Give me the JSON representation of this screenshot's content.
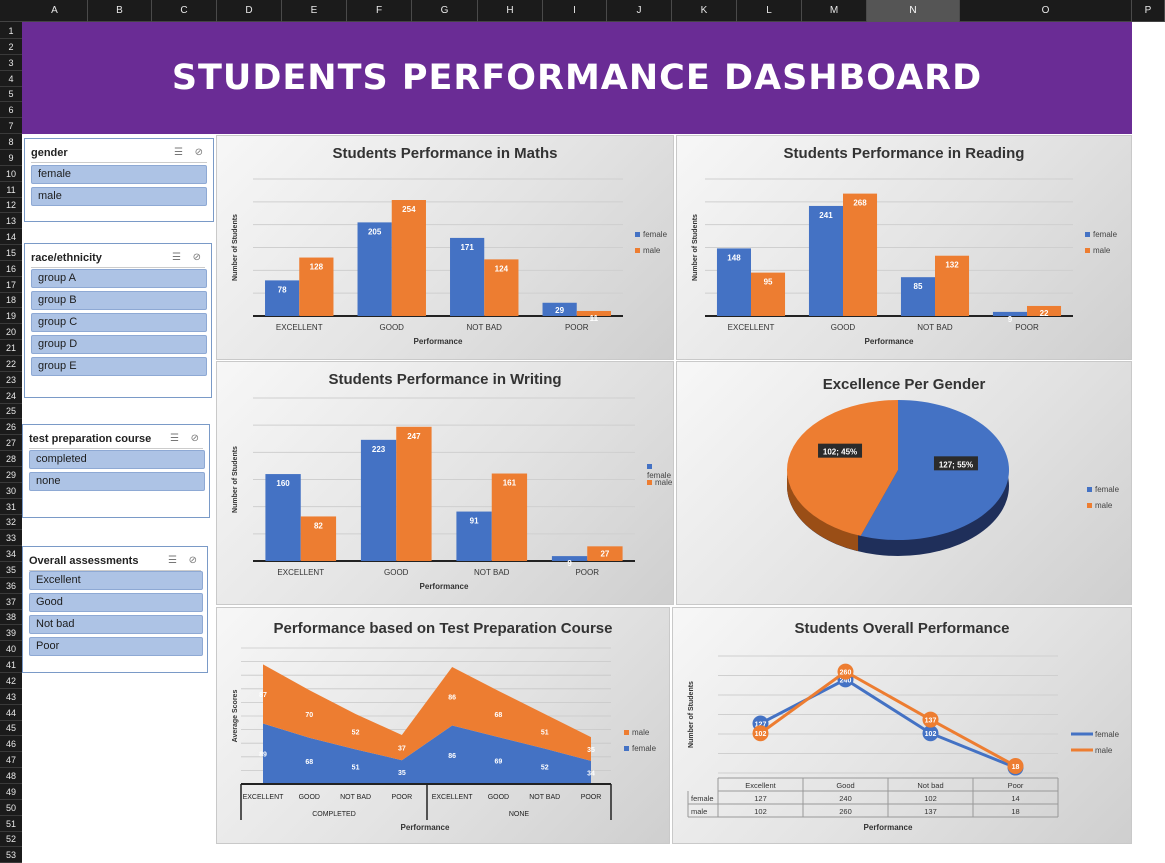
{
  "spreadsheet": {
    "columns": [
      "A",
      "B",
      "C",
      "D",
      "E",
      "F",
      "G",
      "H",
      "I",
      "J",
      "K",
      "L",
      "M",
      "N",
      "O",
      "P"
    ],
    "rows": [
      "1",
      "2",
      "3",
      "4",
      "5",
      "6",
      "7",
      "8",
      "9",
      "10",
      "11",
      "12",
      "13",
      "14",
      "15",
      "16",
      "17",
      "18",
      "19",
      "20",
      "21",
      "22",
      "23",
      "24",
      "25",
      "26",
      "27",
      "28",
      "29",
      "30",
      "31",
      "32",
      "33",
      "34",
      "35",
      "36",
      "37",
      "38",
      "39",
      "40",
      "41",
      "42",
      "43",
      "44",
      "45",
      "46",
      "47",
      "48",
      "49",
      "50",
      "51",
      "52",
      "53"
    ],
    "selected_column": "N"
  },
  "banner": {
    "title": "STUDENTS PERFORMANCE DASHBOARD"
  },
  "slicers": {
    "gender": {
      "title": "gender",
      "items": [
        "female",
        "male"
      ]
    },
    "race": {
      "title": "race/ethnicity",
      "items": [
        "group A",
        "group B",
        "group C",
        "group D",
        "group E"
      ]
    },
    "prep": {
      "title": "test preparation course",
      "items": [
        "completed",
        "none"
      ]
    },
    "overall": {
      "title": "Overall assessments",
      "items": [
        "Excellent",
        "Good",
        "Not bad",
        "Poor"
      ]
    }
  },
  "colors": {
    "female": "#4472c4",
    "male": "#ed7d31",
    "banner": "#6a2c95"
  },
  "legend": {
    "female": "female",
    "male": "male"
  },
  "chart_data": [
    {
      "id": "maths",
      "type": "bar",
      "title": "Students Performance in Maths",
      "categories": [
        "EXCELLENT",
        "GOOD",
        "NOT BAD",
        "POOR"
      ],
      "series": [
        {
          "name": "female",
          "values": [
            78,
            205,
            171,
            29
          ]
        },
        {
          "name": "male",
          "values": [
            128,
            254,
            124,
            11
          ]
        }
      ],
      "xlabel": "Performance",
      "ylabel": "Number of Students",
      "ylim": [
        0,
        300
      ]
    },
    {
      "id": "reading",
      "type": "bar",
      "title": "Students Performance in Reading",
      "categories": [
        "EXCELLENT",
        "GOOD",
        "NOT BAD",
        "POOR"
      ],
      "series": [
        {
          "name": "female",
          "values": [
            148,
            241,
            85,
            9
          ]
        },
        {
          "name": "male",
          "values": [
            95,
            268,
            132,
            22
          ]
        }
      ],
      "xlabel": "Performance",
      "ylabel": "Number of Students",
      "ylim": [
        0,
        300
      ]
    },
    {
      "id": "writing",
      "type": "bar",
      "title": "Students Performance in Writing",
      "categories": [
        "EXCELLENT",
        "GOOD",
        "NOT BAD",
        "POOR"
      ],
      "series": [
        {
          "name": "female",
          "values": [
            160,
            223,
            91,
            9
          ]
        },
        {
          "name": "male",
          "values": [
            82,
            247,
            161,
            27
          ]
        }
      ],
      "xlabel": "Performance",
      "ylabel": "Number of Students",
      "ylim": [
        0,
        300
      ]
    },
    {
      "id": "gender_pie",
      "type": "pie",
      "title": "Excellence Per Gender",
      "slices": [
        {
          "name": "female",
          "value": 127,
          "label": "127; 55%"
        },
        {
          "name": "male",
          "value": 102,
          "label": "102; 45%"
        }
      ]
    },
    {
      "id": "prep_area",
      "type": "area",
      "title": "Performance based on Test Preparation Course",
      "groups": [
        "COMPLETED",
        "NONE"
      ],
      "categories": [
        "EXCELLENT",
        "GOOD",
        "NOT BAD",
        "POOR",
        "EXCELLENT",
        "GOOD",
        "NOT BAD",
        "POOR"
      ],
      "series": [
        {
          "name": "female",
          "values": [
            89,
            68,
            51,
            35,
            86,
            69,
            52,
            34
          ]
        },
        {
          "name": "male",
          "values": [
            87,
            70,
            52,
            37,
            86,
            68,
            51,
            35
          ]
        }
      ],
      "stacked": true,
      "xlabel": "Performance",
      "ylabel": "Average Scores"
    },
    {
      "id": "overall_line",
      "type": "line",
      "title": "Students Overall Performance",
      "categories": [
        "Excellent",
        "Good",
        "Not bad",
        "Poor"
      ],
      "series": [
        {
          "name": "female",
          "values": [
            127,
            240,
            102,
            14
          ]
        },
        {
          "name": "male",
          "values": [
            102,
            260,
            137,
            18
          ]
        }
      ],
      "xlabel": "Performance",
      "ylabel": "Number of Students",
      "ylim": [
        0,
        300
      ]
    }
  ]
}
